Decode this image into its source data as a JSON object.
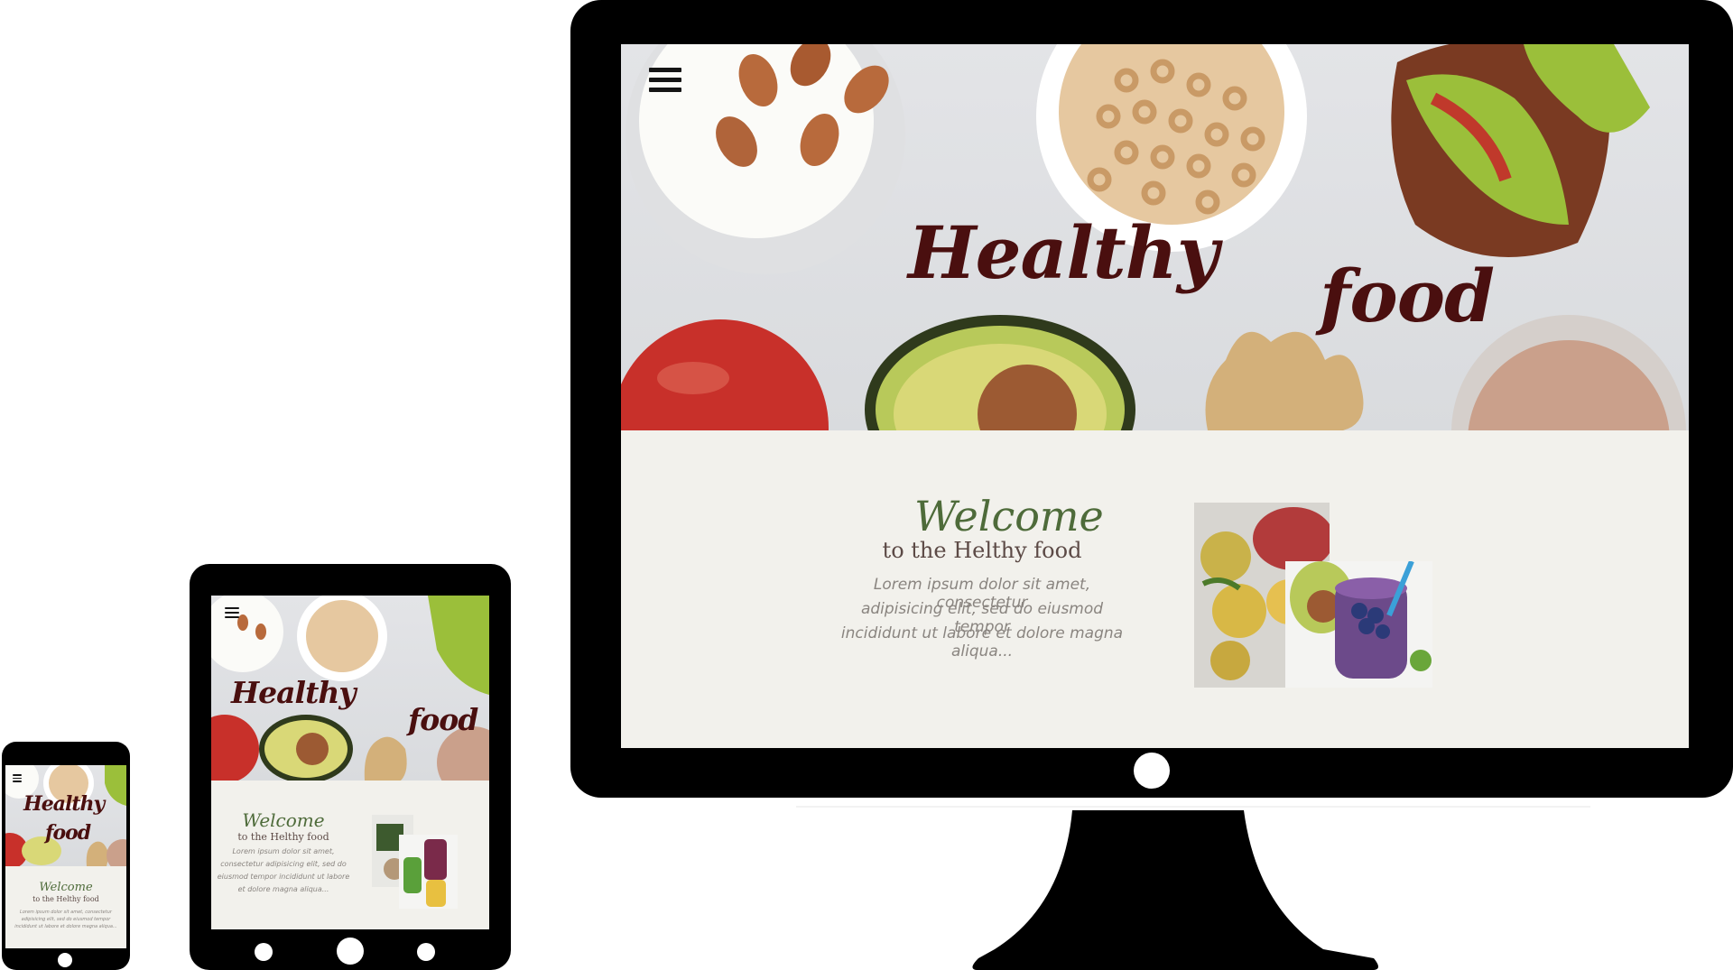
{
  "hero": {
    "word1": "Healthy",
    "word2": "food"
  },
  "welcome": {
    "script_title": "Welcome",
    "subtitle": "to the Helthy food",
    "lorem_line1": "Lorem ipsum dolor sit amet, consectetur",
    "lorem_line2": "adipisicing elit, sed do eiusmod tempor",
    "lorem_line3": "incididunt ut labore et dolore magna aliqua...",
    "lorem_tablet1": "Lorem ipsum dolor sit amet,",
    "lorem_tablet2": "consectetur adipisicing elit, sed do",
    "lorem_tablet3": "eiusmod tempor incididunt ut labore",
    "lorem_tablet4": "et dolore magna aliqua...",
    "lorem_phone1": "Lorem ipsum dolor sit amet, consectetur",
    "lorem_phone2": "adipisicing elit, sed do eiusmod tempor",
    "lorem_phone3": "incididunt ut labore et dolore magna aliqua..."
  },
  "colors": {
    "heading": "#4a0f0f",
    "welcome": "#4e6b3a",
    "page_bg": "#f2f1ec",
    "device": "#000000"
  },
  "icons": {
    "menu": "hamburger-menu-icon"
  }
}
